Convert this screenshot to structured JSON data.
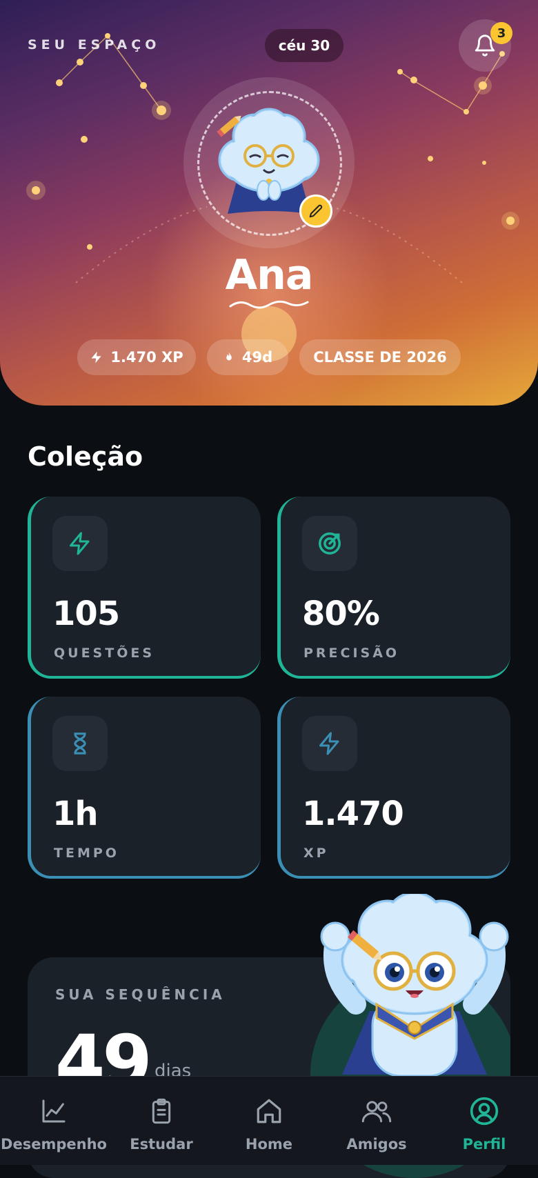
{
  "header": {
    "space_label": "SEU ESPAÇO",
    "sky_label": "céu 30",
    "notifications_count": "3"
  },
  "profile": {
    "name": "Ana",
    "xp_pill": "1.470 XP",
    "streak_pill": "49d",
    "class_pill": "CLASSE DE 2026"
  },
  "collection": {
    "title": "Coleção",
    "cards": [
      {
        "value": "105",
        "label": "QUESTÕES",
        "icon": "lightning-icon",
        "accent": "#1fb596"
      },
      {
        "value": "80%",
        "label": "PRECISÃO",
        "icon": "target-icon",
        "accent": "#1fb596"
      },
      {
        "value": "1h",
        "label": "TEMPO",
        "icon": "hourglass-icon",
        "accent": "#3b8fb5"
      },
      {
        "value": "1.470",
        "label": "XP",
        "icon": "lightning-icon",
        "accent": "#3b8fb5"
      }
    ]
  },
  "streak": {
    "label": "SUA SEQUÊNCIA",
    "number": "49",
    "unit": "dias"
  },
  "tabbar": {
    "items": [
      {
        "label": "Desempenho",
        "icon": "chart-line-icon",
        "active": false
      },
      {
        "label": "Estudar",
        "icon": "clipboard-icon",
        "active": false
      },
      {
        "label": "Home",
        "icon": "home-icon",
        "active": false
      },
      {
        "label": "Amigos",
        "icon": "users-icon",
        "active": false
      },
      {
        "label": "Perfil",
        "icon": "profile-icon",
        "active": true
      }
    ]
  },
  "colors": {
    "accent_green": "#1fb596",
    "accent_blue": "#3b8fb5",
    "badge_yellow": "#fbc531",
    "background": "#0b0f13"
  }
}
